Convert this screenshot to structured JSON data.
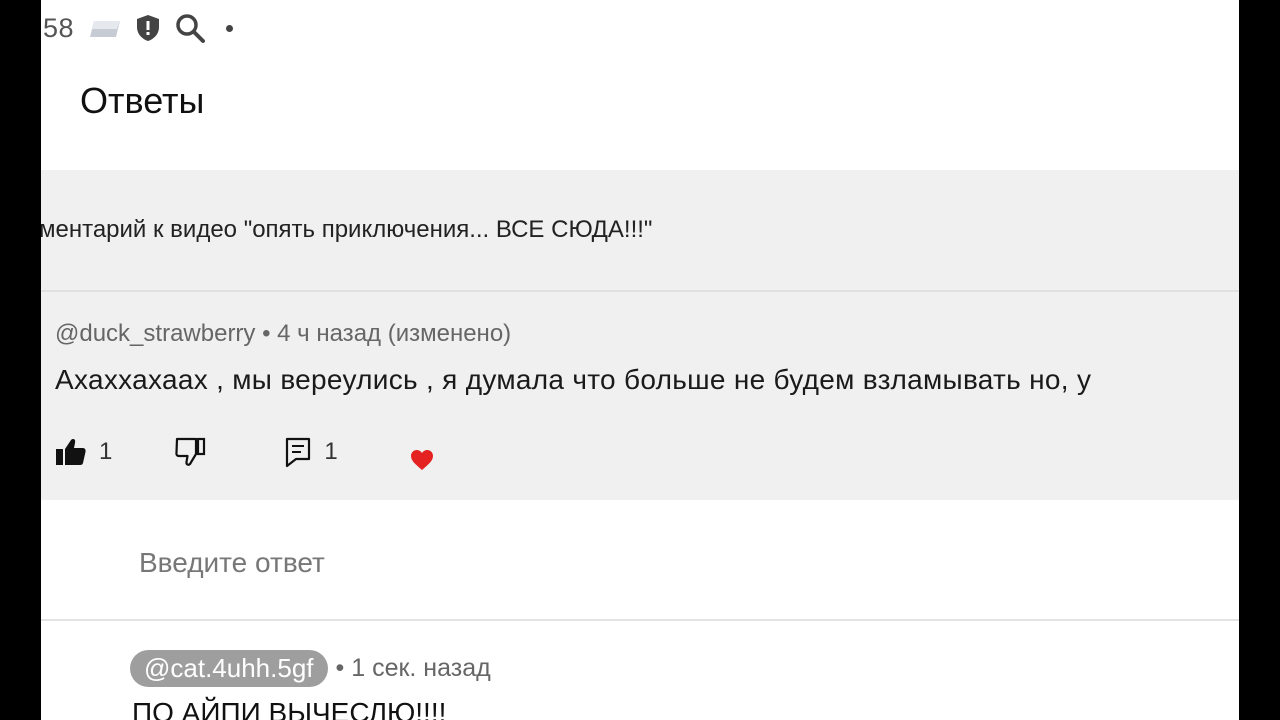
{
  "status_bar": {
    "time": "58",
    "icons": [
      "gallery-icon",
      "shield-icon",
      "search-icon",
      "dot-icon"
    ]
  },
  "header": {
    "title": "Ответы"
  },
  "context": {
    "video_reference": "ментарий к видео \"опять приключения... ВСЕ СЮДА!!!\""
  },
  "comment": {
    "meta": "@duck_strawberry • 4 ч назад (изменено)",
    "text": "Ахаххахаах , мы вереулись , я думала что больше не будем взламывать но, у",
    "likes": "1",
    "replies": "1",
    "icons": {
      "like": "thumbs-up-icon",
      "dislike": "thumbs-down-icon",
      "reply": "reply-icon",
      "heart": "heart-icon"
    },
    "heart_color": "#e52222"
  },
  "reply_box": {
    "placeholder": "Введите ответ"
  },
  "reply": {
    "author": "@cat.4uhh.5gf",
    "time": "• 1 сек. назад",
    "text": "ПО АЙПИ ВЫЧЕСЛЮ!!!!"
  }
}
